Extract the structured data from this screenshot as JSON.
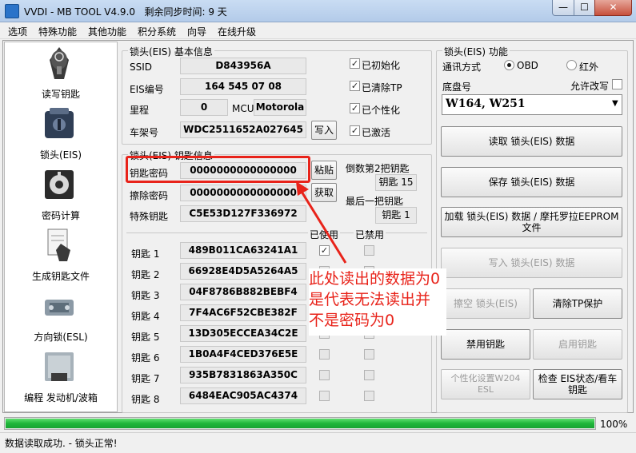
{
  "window": {
    "title": "VVDI - MB TOOL V4.9.0   剩余同步时间: 9 天",
    "min": "—",
    "max": "☐",
    "close": "✕"
  },
  "menu": [
    "选项",
    "特殊功能",
    "其他功能",
    "积分系统",
    "向导",
    "在线升级"
  ],
  "sidebar": [
    {
      "label": "读写钥匙",
      "icon": "key-fob-icon"
    },
    {
      "label": "锁头(EIS)",
      "icon": "eis-lock-icon"
    },
    {
      "label": "密码计算",
      "icon": "password-calc-icon"
    },
    {
      "label": "生成钥匙文件",
      "icon": "key-file-icon"
    },
    {
      "label": "方向锁(ESL)",
      "icon": "steering-lock-icon"
    },
    {
      "label": "编程 发动机/波箱",
      "icon": "ecu-icon"
    }
  ],
  "eis_info": {
    "title": "锁头(EIS) 基本信息",
    "ssid_label": "SSID",
    "ssid": "D843956A",
    "eis_no_label": "EIS编号",
    "eis_no": "164 545 07 08",
    "mileage_label": "里程",
    "mileage": "0",
    "mcu_label": "MCU",
    "mcu": "Motorola",
    "vin_label": "车架号",
    "vin": "WDC2511652A027645",
    "write_button": "写入",
    "flags": [
      {
        "label": "已初始化",
        "checked": true
      },
      {
        "label": "已清除TP",
        "checked": true
      },
      {
        "label": "已个性化",
        "checked": true
      },
      {
        "label": "已激活",
        "checked": true
      }
    ]
  },
  "key_info": {
    "title": "锁头(EIS) 钥匙信息",
    "key_password_label": "钥匙密码",
    "key_password": "0000000000000000",
    "paste_button": "粘贴",
    "erase_password_label": "擦除密码",
    "erase_password": "0000000000000000",
    "get_button": "获取",
    "special_key_label": "特殊钥匙",
    "special_key": "C5E53D127F336972",
    "second_last_label": "倒数第2把钥匙",
    "second_last_value": "钥匙 15",
    "last_label": "最后一把钥匙",
    "last_value": "钥匙 1",
    "used_header": "已使用",
    "disabled_header": "已禁用",
    "keys": [
      {
        "label": "钥匙 1",
        "value": "489B011CA63241A1",
        "used": true,
        "disabled": false
      },
      {
        "label": "钥匙 2",
        "value": "66928E4D5A5264A5",
        "used": false,
        "disabled": false
      },
      {
        "label": "钥匙 3",
        "value": "04F8786B882BEBF4",
        "used": false,
        "disabled": false
      },
      {
        "label": "钥匙 4",
        "value": "7F4AC6F52CBE382F",
        "used": false,
        "disabled": false
      },
      {
        "label": "钥匙 5",
        "value": "13D305ECCEA34C2E",
        "used": false,
        "disabled": false
      },
      {
        "label": "钥匙 6",
        "value": "1B0A4F4CED376E5E",
        "used": false,
        "disabled": false
      },
      {
        "label": "钥匙 7",
        "value": "935B7831863A350C",
        "used": false,
        "disabled": false
      },
      {
        "label": "钥匙 8",
        "value": "6484EAC905AC4374",
        "used": false,
        "disabled": false
      }
    ]
  },
  "eis_function": {
    "title": "锁头(EIS) 功能",
    "comm_label": "通讯方式",
    "obd_label": "OBD",
    "ir_label": "红外",
    "selected": "OBD",
    "chassis_label": "底盘号",
    "allow_edit_label": "允许改写",
    "chassis_value": "W164, W251",
    "buttons": [
      {
        "label": "读取 锁头(EIS) 数据",
        "enabled": true
      },
      {
        "label": "保存 锁头(EIS) 数据",
        "enabled": true
      },
      {
        "label": "加载 锁头(EIS) 数据 / 摩托罗拉EEPROM 文件",
        "enabled": true
      },
      {
        "label": "写入 锁头(EIS) 数据",
        "enabled": false
      },
      {
        "label": "擦空 锁头(EIS)",
        "enabled": false
      },
      {
        "label": "清除TP保护",
        "enabled": true
      },
      {
        "label": "禁用钥匙",
        "enabled": true
      },
      {
        "label": "启用钥匙",
        "enabled": false
      },
      {
        "label": "个性化设置W204 ESL",
        "enabled": false
      },
      {
        "label": "检查 EIS状态/看车钥匙",
        "enabled": true
      }
    ]
  },
  "annotation": {
    "line1": "此处读出的数据为0",
    "line2": "是代表无法读出并",
    "line3": "不是密码为0",
    "color": "#e8231a"
  },
  "progress": {
    "value": 1.0,
    "label": "100%"
  },
  "status": {
    "text": "数据读取成功. - 锁头正常!"
  }
}
